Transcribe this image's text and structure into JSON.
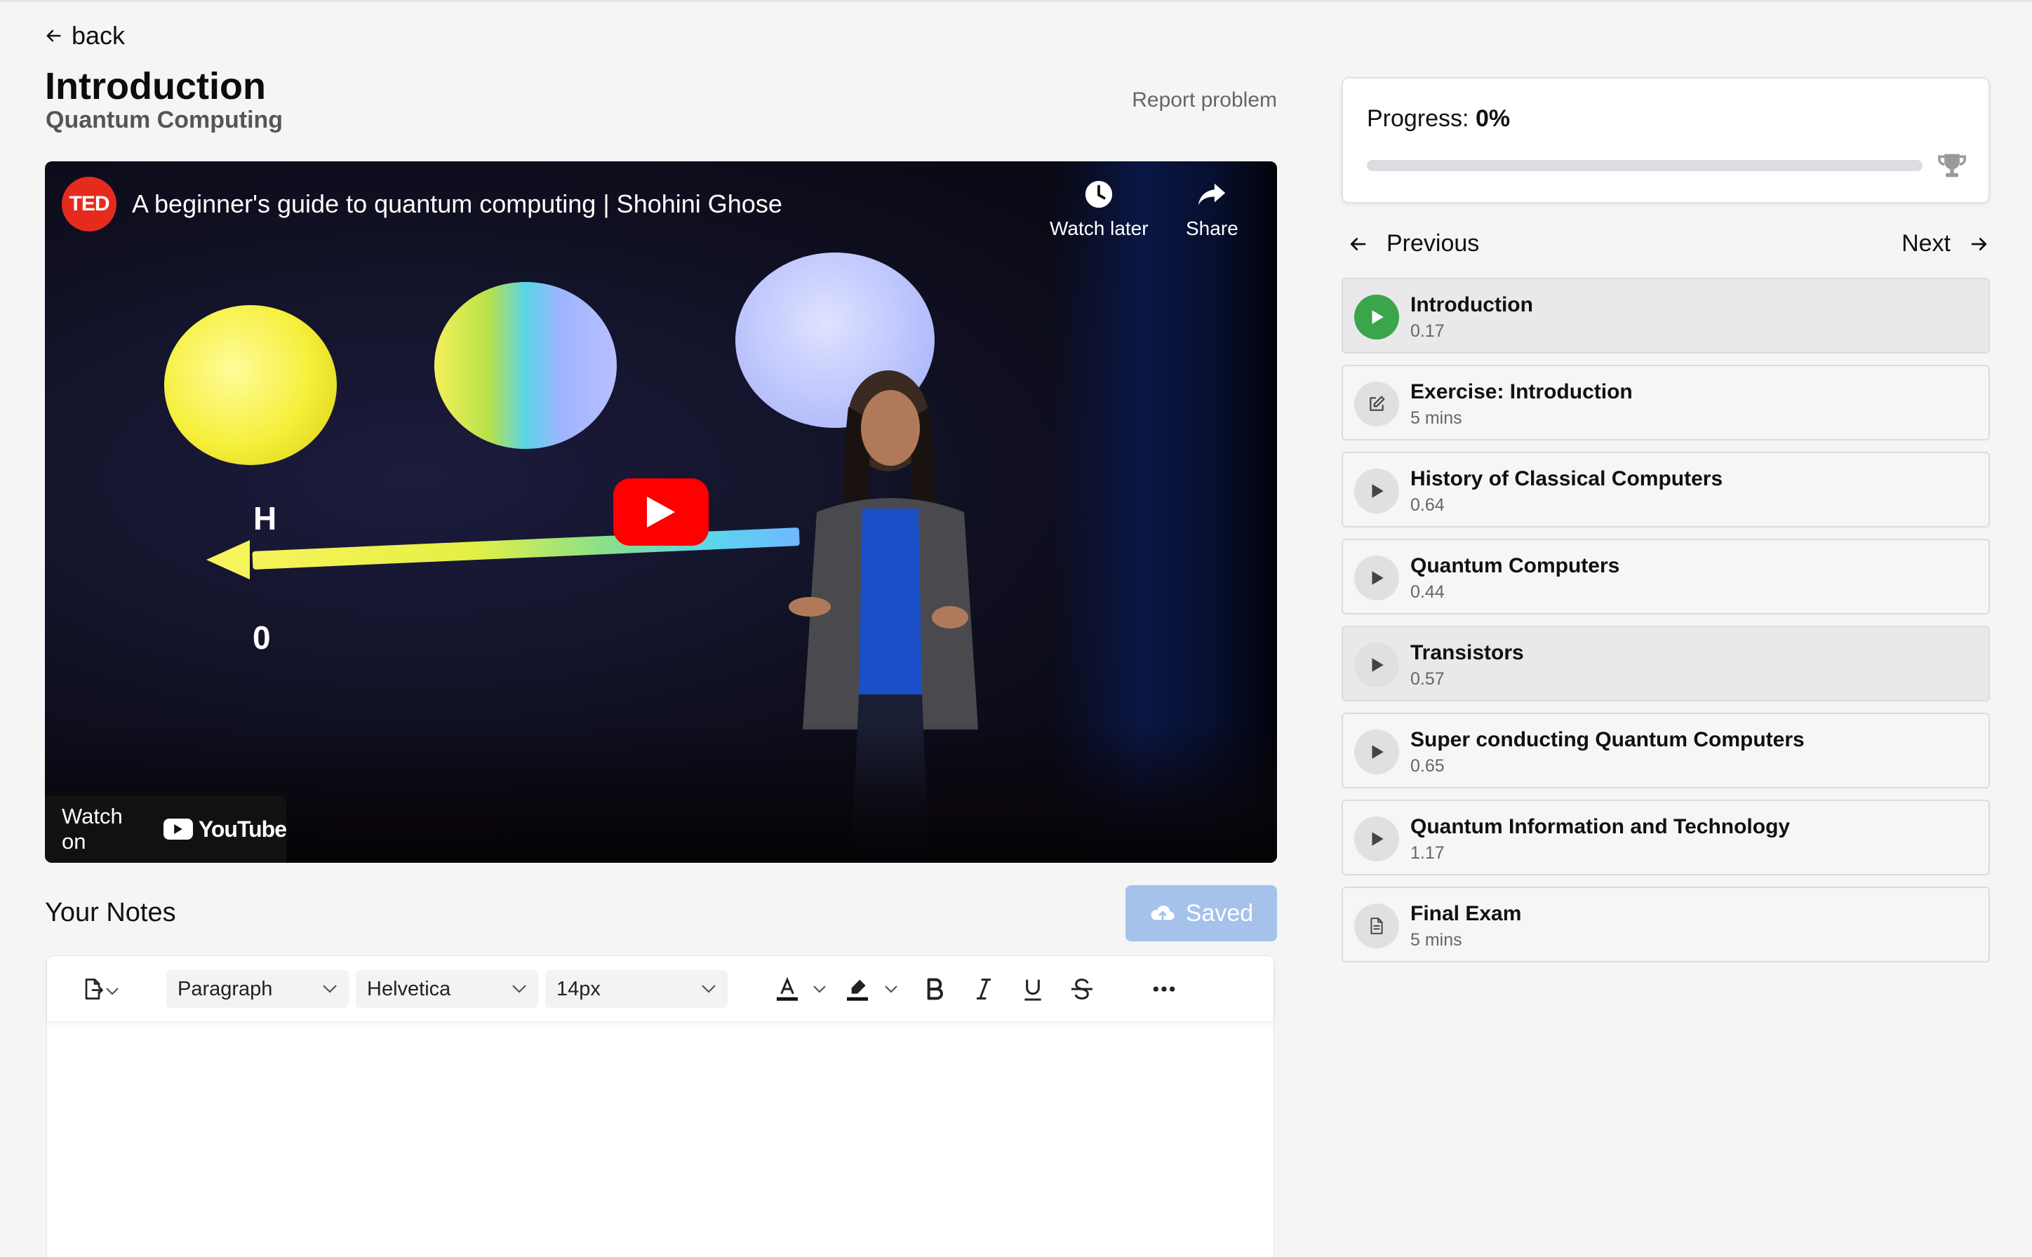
{
  "nav": {
    "back_label": "back"
  },
  "lesson": {
    "title": "Introduction",
    "course": "Quantum Computing",
    "report_label": "Report problem"
  },
  "video": {
    "channel_logo_text": "TED",
    "title": "A beginner's guide to quantum computing | Shohini Ghose",
    "watch_later_label": "Watch later",
    "share_label": "Share",
    "watch_on_label": "Watch on",
    "youtube_label": "YouTube",
    "scene_label_h": "H",
    "scene_label_0": "0"
  },
  "notes": {
    "title": "Your Notes",
    "saved_label": "Saved",
    "toolbar": {
      "block_format": "Paragraph",
      "font_family": "Helvetica",
      "font_size": "14px"
    }
  },
  "progress": {
    "label": "Progress:",
    "value": 0,
    "value_text": "0%"
  },
  "pager": {
    "previous_label": "Previous",
    "next_label": "Next"
  },
  "lessons": [
    {
      "title": "Introduction",
      "meta": "0.17",
      "icon": "play-icon",
      "state": "current"
    },
    {
      "title": "Exercise: Introduction",
      "meta": "5 mins",
      "icon": "edit-icon",
      "state": "default"
    },
    {
      "title": "History of Classical Computers",
      "meta": "0.64",
      "icon": "play-icon",
      "state": "default"
    },
    {
      "title": "Quantum Computers",
      "meta": "0.44",
      "icon": "play-icon",
      "state": "default"
    },
    {
      "title": "Transistors",
      "meta": "0.57",
      "icon": "play-icon",
      "state": "hover"
    },
    {
      "title": "Super conducting Quantum Computers",
      "meta": "0.65",
      "icon": "play-icon",
      "state": "default"
    },
    {
      "title": "Quantum Information and Technology",
      "meta": "1.17",
      "icon": "play-icon",
      "state": "default"
    },
    {
      "title": "Final Exam",
      "meta": "5 mins",
      "icon": "document-icon",
      "state": "default"
    }
  ],
  "colors": {
    "accent_green": "#3aa54a",
    "saved_button": "#a4c2ea",
    "youtube_red": "#ff0000",
    "ted_red": "#e62b1e"
  }
}
